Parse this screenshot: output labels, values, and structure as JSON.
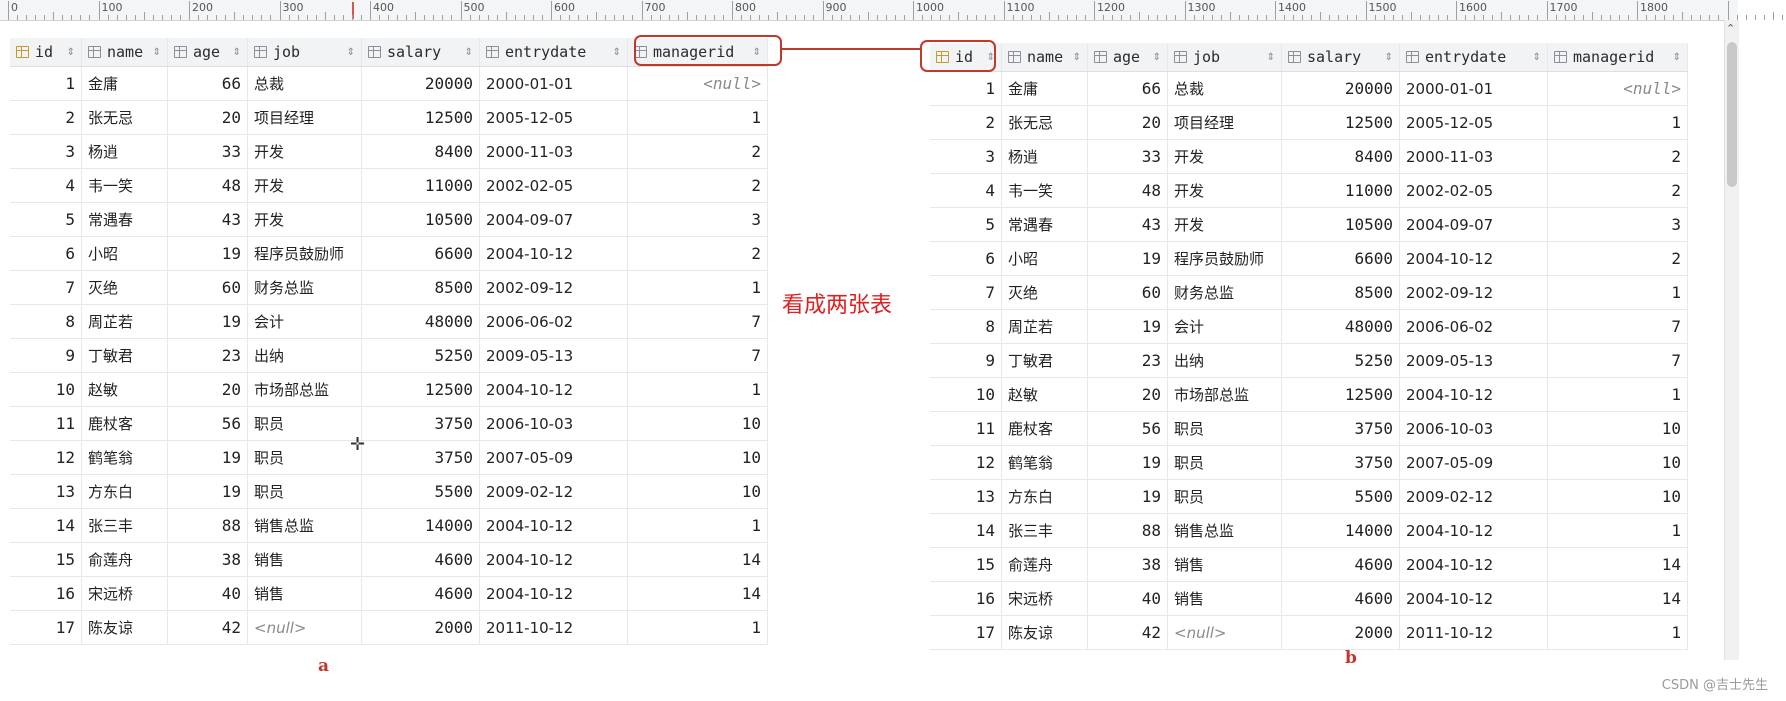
{
  "ruler": {
    "labels": [
      "0",
      "100",
      "200",
      "300",
      "400",
      "500",
      "600",
      "700",
      "800",
      "900",
      "1000",
      "1100",
      "1200",
      "1300",
      "1400",
      "1500",
      "1600",
      "1700",
      "1800"
    ]
  },
  "columns": [
    {
      "key": "id",
      "label": "id",
      "icon": "primary-key-icon"
    },
    {
      "key": "name",
      "label": "name",
      "icon": "column-icon"
    },
    {
      "key": "age",
      "label": "age",
      "icon": "column-icon"
    },
    {
      "key": "job",
      "label": "job",
      "icon": "column-icon"
    },
    {
      "key": "salary",
      "label": "salary",
      "icon": "column-icon"
    },
    {
      "key": "entrydate",
      "label": "entrydate",
      "icon": "column-icon"
    },
    {
      "key": "managerid",
      "label": "managerid",
      "icon": "column-icon"
    }
  ],
  "rows": [
    [
      "1",
      "金庸",
      "66",
      "总裁",
      "20000",
      "2000-01-01",
      "<null>"
    ],
    [
      "2",
      "张无忌",
      "20",
      "项目经理",
      "12500",
      "2005-12-05",
      "1"
    ],
    [
      "3",
      "杨逍",
      "33",
      "开发",
      "8400",
      "2000-11-03",
      "2"
    ],
    [
      "4",
      "韦一笑",
      "48",
      "开发",
      "11000",
      "2002-02-05",
      "2"
    ],
    [
      "5",
      "常遇春",
      "43",
      "开发",
      "10500",
      "2004-09-07",
      "3"
    ],
    [
      "6",
      "小昭",
      "19",
      "程序员鼓励师",
      "6600",
      "2004-10-12",
      "2"
    ],
    [
      "7",
      "灭绝",
      "60",
      "财务总监",
      "8500",
      "2002-09-12",
      "1"
    ],
    [
      "8",
      "周芷若",
      "19",
      "会计",
      "48000",
      "2006-06-02",
      "7"
    ],
    [
      "9",
      "丁敏君",
      "23",
      "出纳",
      "5250",
      "2009-05-13",
      "7"
    ],
    [
      "10",
      "赵敏",
      "20",
      "市场部总监",
      "12500",
      "2004-10-12",
      "1"
    ],
    [
      "11",
      "鹿杖客",
      "56",
      "职员",
      "3750",
      "2006-10-03",
      "10"
    ],
    [
      "12",
      "鹤笔翁",
      "19",
      "职员",
      "3750",
      "2007-05-09",
      "10"
    ],
    [
      "13",
      "方东白",
      "19",
      "职员",
      "5500",
      "2009-02-12",
      "10"
    ],
    [
      "14",
      "张三丰",
      "88",
      "销售总监",
      "14000",
      "2004-10-12",
      "1"
    ],
    [
      "15",
      "俞莲舟",
      "38",
      "销售",
      "4600",
      "2004-10-12",
      "14"
    ],
    [
      "16",
      "宋远桥",
      "40",
      "销售",
      "4600",
      "2004-10-12",
      "14"
    ],
    [
      "17",
      "陈友谅",
      "42",
      "<null>",
      "2000",
      "2011-10-12",
      "1"
    ]
  ],
  "annotation": {
    "note": "看成两张表",
    "caption_a": "a",
    "caption_b": "b",
    "highlight_color": "#c0392b"
  },
  "watermark": "CSDN @吉士先生"
}
